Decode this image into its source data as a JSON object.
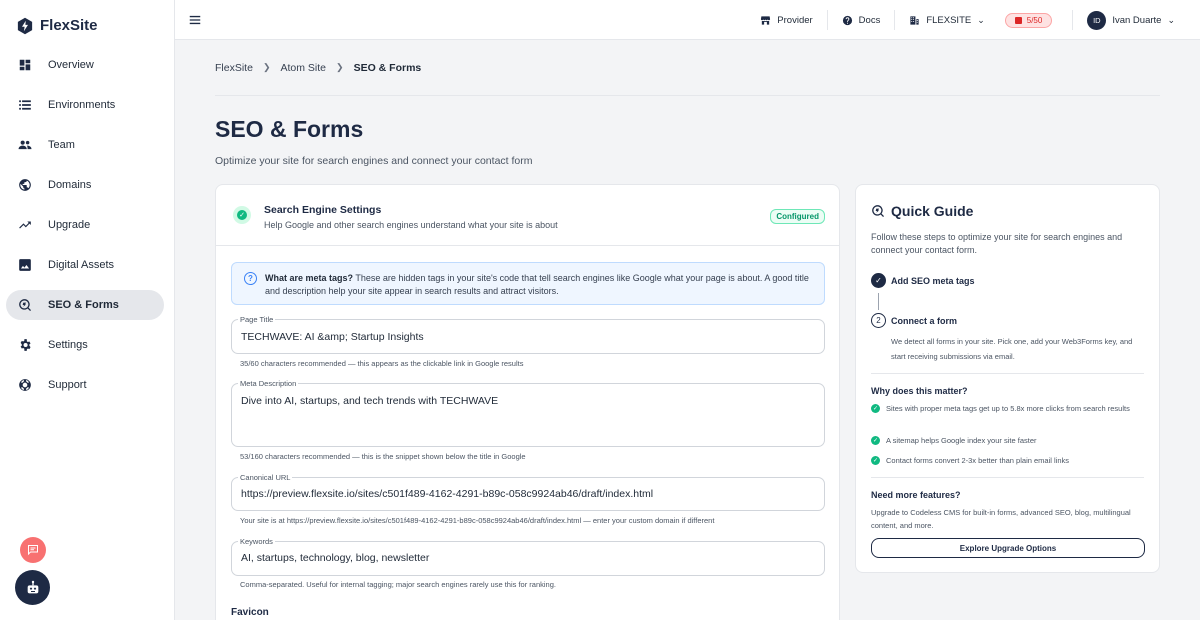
{
  "brand": {
    "name": "FlexSite"
  },
  "sidebar": {
    "items": [
      {
        "label": "Overview",
        "icon": "dashboard-icon"
      },
      {
        "label": "Environments",
        "icon": "list-icon"
      },
      {
        "label": "Team",
        "icon": "people-icon"
      },
      {
        "label": "Domains",
        "icon": "globe-icon"
      },
      {
        "label": "Upgrade",
        "icon": "trending-up-icon"
      },
      {
        "label": "Digital Assets",
        "icon": "image-icon"
      },
      {
        "label": "SEO & Forms",
        "icon": "seo-icon",
        "active": true
      },
      {
        "label": "Settings",
        "icon": "gear-icon"
      },
      {
        "label": "Support",
        "icon": "lifebuoy-icon"
      }
    ]
  },
  "topbar": {
    "provider": "Provider",
    "docs": "Docs",
    "workspace": "FLEXSITE",
    "usage": "5/50",
    "user_initials": "ID",
    "user_name": "Ivan Duarte"
  },
  "breadcrumb": [
    "FlexSite",
    "Atom Site",
    "SEO & Forms"
  ],
  "page": {
    "title": "SEO & Forms",
    "subtitle": "Optimize your site for search engines and connect your contact form"
  },
  "seo_card": {
    "title": "Search Engine Settings",
    "description": "Help Google and other search engines understand what your site is about",
    "status": "Configured",
    "info_bold": "What are meta tags?",
    "info_text": " These are hidden tags in your site's code that tell search engines like Google what your page is about. A good title and description help your site appear in search results and attract visitors.",
    "fields": {
      "page_title": {
        "label": "Page Title",
        "value": "TECHWAVE: AI &amp; Startup Insights",
        "hint": "35/60 characters recommended — this appears as the clickable link in Google results"
      },
      "meta_description": {
        "label": "Meta Description",
        "value": "Dive into AI, startups, and tech trends with TECHWAVE",
        "hint": "53/160 characters recommended — this is the snippet shown below the title in Google"
      },
      "canonical_url": {
        "label": "Canonical URL",
        "value": "https://preview.flexsite.io/sites/c501f489-4162-4291-b89c-058c9924ab46/draft/index.html",
        "hint": "Your site is at https://preview.flexsite.io/sites/c501f489-4162-4291-b89c-058c9924ab46/draft/index.html — enter your custom domain if different"
      },
      "keywords": {
        "label": "Keywords",
        "value": "AI, startups, technology, blog, newsletter",
        "hint": "Comma-separated. Useful for internal tagging; major search engines rarely use this for ranking."
      }
    },
    "favicon_label": "Favicon"
  },
  "guide": {
    "title": "Quick Guide",
    "intro": "Follow these steps to optimize your site for search engines and connect your contact form.",
    "step1": {
      "number": "✓",
      "title": "Add SEO meta tags"
    },
    "step2": {
      "number": "2",
      "title": "Connect a form",
      "description": "We detect all forms in your site. Pick one, add your Web3Forms key, and start receiving submissions via email."
    },
    "why_title": "Why does this matter?",
    "benefits": [
      "Sites with proper meta tags get up to 5.8x more clicks from search results",
      "A sitemap helps Google index your site faster",
      "Contact forms convert 2-3x better than plain email links"
    ],
    "more_title": "Need more features?",
    "more_text": "Upgrade to Codeless CMS for built-in forms, advanced SEO, blog, multilingual content, and more.",
    "cta": "Explore Upgrade Options"
  },
  "colors": {
    "navy": "#1e2a44",
    "success": "#10b981",
    "danger": "#dc2626",
    "info": "#3b82f6"
  }
}
